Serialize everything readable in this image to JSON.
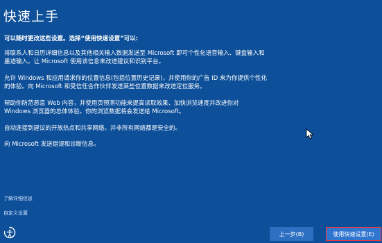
{
  "page": {
    "title": "快速上手",
    "subtitle": "可以随时更改这些设置。选择“使用快速设置”可以:"
  },
  "paragraphs": [
    "将联系人和日历详细信息以及其他相关输入数据发送至 Microsoft 即可个性化语音输入、键盘输入和\n墨迹输入。让 Microsoft 使用该信息来改进建议和识别平台。",
    "允许 Windows 和应用请求你的位置信息(包括位置历史记录)，并使用你的广告 ID 来为你提供个性化\n的体验。向 Microsoft 和受信任合作伙伴发送某些位置数据来改进定位服务。",
    "帮助你防范恶意 Web 内容，并使用页预测功能来提高读取效果、加快浏览速度并改进你对\nWindows 浏览器的总体体验。你的浏览数据将会发送给 Microsoft。",
    "自动连接到建议的开放热点和共享网络。并非所有网络都是安全的。",
    "向 Microsoft 发送错误和诊断信息。"
  ],
  "links": {
    "learn_more": "了解详细信息",
    "customize": "自定义设置"
  },
  "buttons": {
    "back": "上一步(B)",
    "express": "使用快速设置(E)"
  },
  "icons": {
    "accessibility": "ease-of-access-icon",
    "cursor": "mouse-cursor-icon"
  },
  "colors": {
    "background": "#0d4f99",
    "button": "#2d6fc0",
    "highlight_border": "#ff3131"
  }
}
